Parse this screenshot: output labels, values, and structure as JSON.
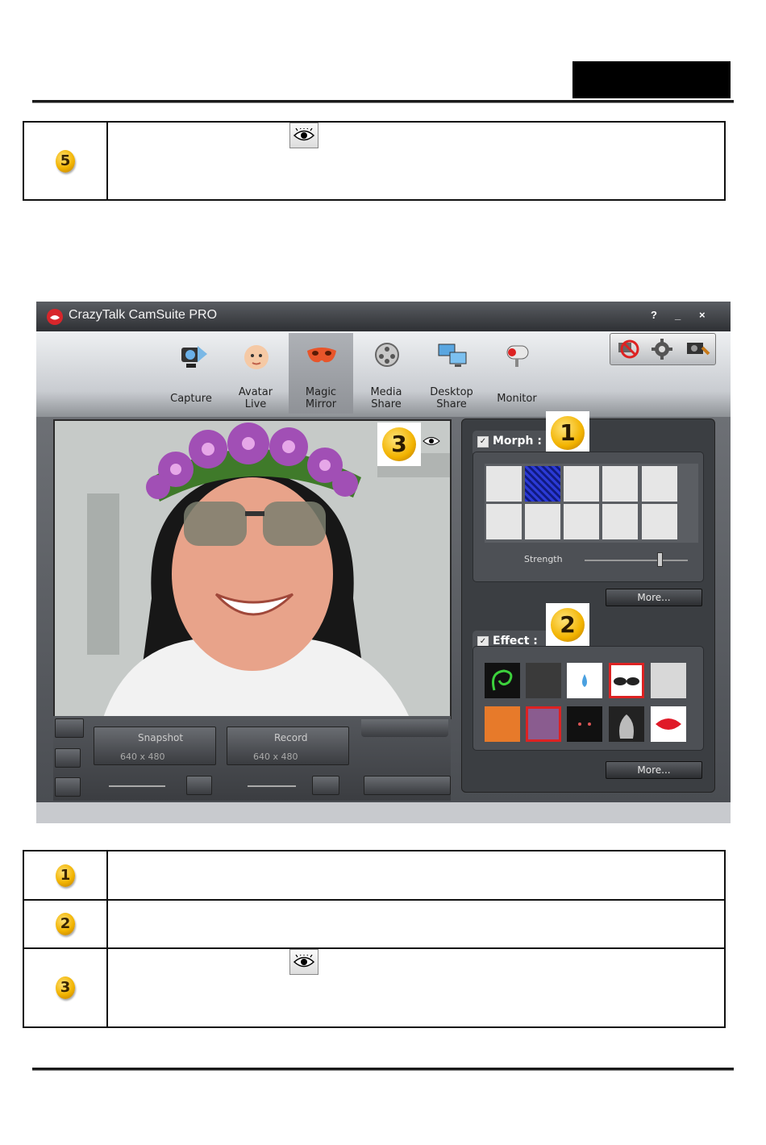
{
  "header": {
    "title_box": ""
  },
  "top_table": {
    "badge": "5"
  },
  "app": {
    "title": "CrazyTalk CamSuite PRO",
    "title_buttons": [
      "?",
      "_",
      "×"
    ],
    "tabs": [
      {
        "label1": "Capture",
        "label2": ""
      },
      {
        "label1": "Avatar",
        "label2": "Live"
      },
      {
        "label1": "Magic",
        "label2": "Mirror"
      },
      {
        "label1": "Media",
        "label2": "Share"
      },
      {
        "label1": "Desktop",
        "label2": "Share"
      },
      {
        "label1": "Monitor",
        "label2": ""
      }
    ],
    "morph": {
      "label": "Morph :",
      "strength_label": "Strength",
      "more": "More..."
    },
    "effect": {
      "label": "Effect :",
      "more": "More..."
    },
    "callouts": [
      "1",
      "2",
      "3"
    ],
    "snapshot": {
      "label": "Snapshot",
      "res": "640 x 480"
    },
    "record": {
      "label": "Record",
      "res": "640 x 480"
    }
  },
  "bottom_table": {
    "badges": [
      "1",
      "2",
      "3"
    ]
  }
}
